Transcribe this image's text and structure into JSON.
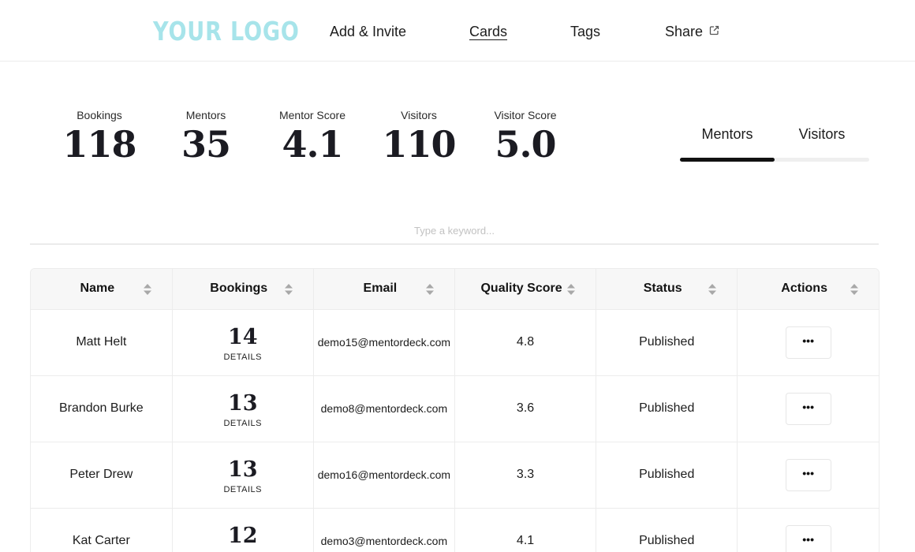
{
  "header": {
    "logo": "YOUR LOGO",
    "nav": [
      {
        "label": "Add & Invite"
      },
      {
        "label": "Cards",
        "active": true
      },
      {
        "label": "Tags"
      },
      {
        "label": "Share",
        "icon": "external-link-icon"
      }
    ]
  },
  "stats": [
    {
      "label": "Bookings",
      "value": "118"
    },
    {
      "label": "Mentors",
      "value": "35"
    },
    {
      "label": "Mentor Score",
      "value": "4.1"
    },
    {
      "label": "Visitors",
      "value": "110"
    },
    {
      "label": "Visitor Score",
      "value": "5.0"
    }
  ],
  "tabs": {
    "items": [
      "Mentors",
      "Visitors"
    ],
    "selected": "Mentors"
  },
  "search": {
    "placeholder": "Type a keyword...",
    "value": ""
  },
  "table": {
    "columns": [
      "Name",
      "Bookings",
      "Email",
      "Quality Score",
      "Status",
      "Actions"
    ],
    "details_label": "DETAILS",
    "actions_label": "•••",
    "rows": [
      {
        "name": "Matt Helt",
        "bookings": "14",
        "email": "demo15@mentordeck.com",
        "score": "4.8",
        "status": "Published"
      },
      {
        "name": "Brandon Burke",
        "bookings": "13",
        "email": "demo8@mentordeck.com",
        "score": "3.6",
        "status": "Published"
      },
      {
        "name": "Peter Drew",
        "bookings": "13",
        "email": "demo16@mentordeck.com",
        "score": "3.3",
        "status": "Published"
      },
      {
        "name": "Kat Carter",
        "bookings": "12",
        "email": "demo3@mentordeck.com",
        "score": "4.1",
        "status": "Published"
      }
    ]
  },
  "colors": {
    "logo": "#a7e4ea",
    "tab_active": "#111111",
    "tab_track": "#efefef",
    "table_header_bg": "#f7f7f7",
    "border": "#ececec"
  }
}
